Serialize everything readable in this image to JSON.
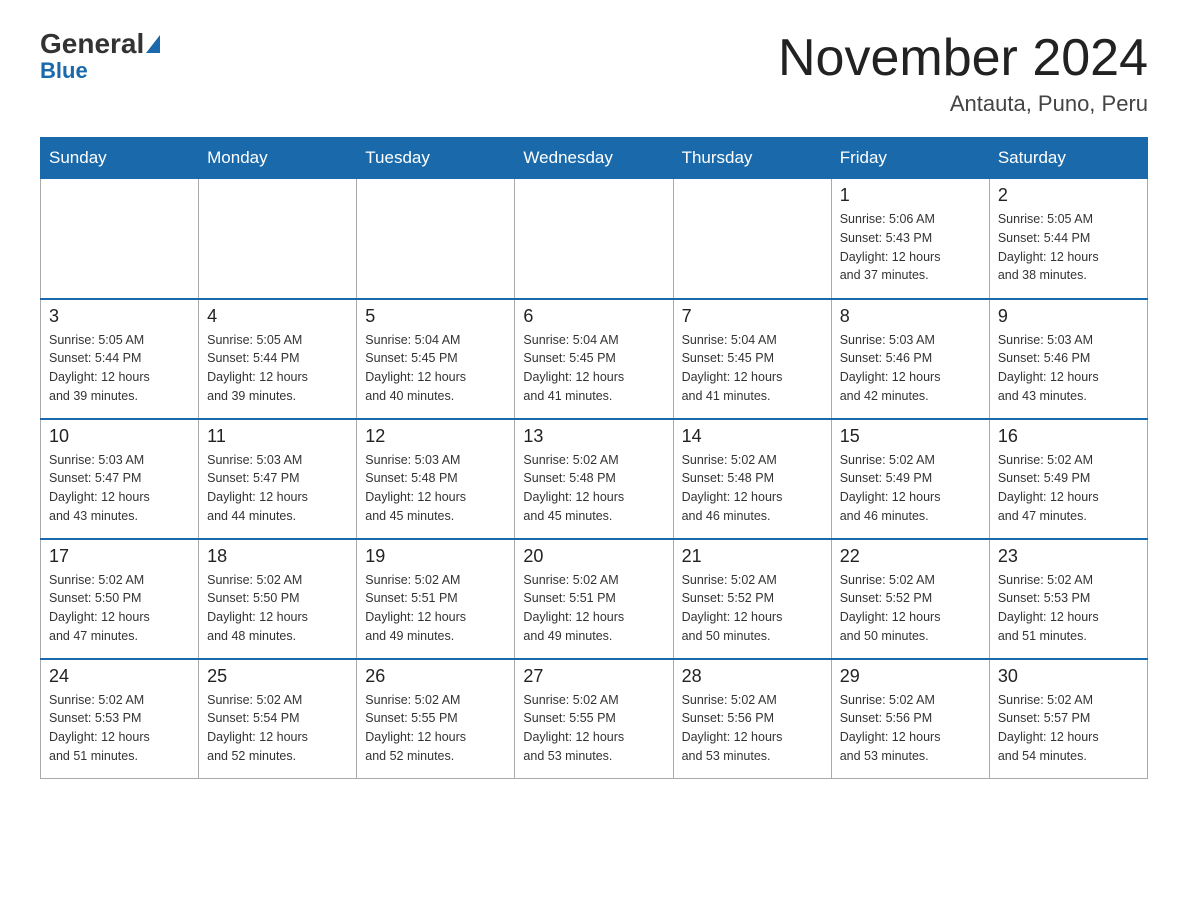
{
  "header": {
    "logo_general": "General",
    "logo_blue": "Blue",
    "month_title": "November 2024",
    "location": "Antauta, Puno, Peru"
  },
  "days_of_week": [
    "Sunday",
    "Monday",
    "Tuesday",
    "Wednesday",
    "Thursday",
    "Friday",
    "Saturday"
  ],
  "weeks": [
    {
      "days": [
        {
          "date": "",
          "info": ""
        },
        {
          "date": "",
          "info": ""
        },
        {
          "date": "",
          "info": ""
        },
        {
          "date": "",
          "info": ""
        },
        {
          "date": "",
          "info": ""
        },
        {
          "date": "1",
          "info": "Sunrise: 5:06 AM\nSunset: 5:43 PM\nDaylight: 12 hours\nand 37 minutes."
        },
        {
          "date": "2",
          "info": "Sunrise: 5:05 AM\nSunset: 5:44 PM\nDaylight: 12 hours\nand 38 minutes."
        }
      ]
    },
    {
      "days": [
        {
          "date": "3",
          "info": "Sunrise: 5:05 AM\nSunset: 5:44 PM\nDaylight: 12 hours\nand 39 minutes."
        },
        {
          "date": "4",
          "info": "Sunrise: 5:05 AM\nSunset: 5:44 PM\nDaylight: 12 hours\nand 39 minutes."
        },
        {
          "date": "5",
          "info": "Sunrise: 5:04 AM\nSunset: 5:45 PM\nDaylight: 12 hours\nand 40 minutes."
        },
        {
          "date": "6",
          "info": "Sunrise: 5:04 AM\nSunset: 5:45 PM\nDaylight: 12 hours\nand 41 minutes."
        },
        {
          "date": "7",
          "info": "Sunrise: 5:04 AM\nSunset: 5:45 PM\nDaylight: 12 hours\nand 41 minutes."
        },
        {
          "date": "8",
          "info": "Sunrise: 5:03 AM\nSunset: 5:46 PM\nDaylight: 12 hours\nand 42 minutes."
        },
        {
          "date": "9",
          "info": "Sunrise: 5:03 AM\nSunset: 5:46 PM\nDaylight: 12 hours\nand 43 minutes."
        }
      ]
    },
    {
      "days": [
        {
          "date": "10",
          "info": "Sunrise: 5:03 AM\nSunset: 5:47 PM\nDaylight: 12 hours\nand 43 minutes."
        },
        {
          "date": "11",
          "info": "Sunrise: 5:03 AM\nSunset: 5:47 PM\nDaylight: 12 hours\nand 44 minutes."
        },
        {
          "date": "12",
          "info": "Sunrise: 5:03 AM\nSunset: 5:48 PM\nDaylight: 12 hours\nand 45 minutes."
        },
        {
          "date": "13",
          "info": "Sunrise: 5:02 AM\nSunset: 5:48 PM\nDaylight: 12 hours\nand 45 minutes."
        },
        {
          "date": "14",
          "info": "Sunrise: 5:02 AM\nSunset: 5:48 PM\nDaylight: 12 hours\nand 46 minutes."
        },
        {
          "date": "15",
          "info": "Sunrise: 5:02 AM\nSunset: 5:49 PM\nDaylight: 12 hours\nand 46 minutes."
        },
        {
          "date": "16",
          "info": "Sunrise: 5:02 AM\nSunset: 5:49 PM\nDaylight: 12 hours\nand 47 minutes."
        }
      ]
    },
    {
      "days": [
        {
          "date": "17",
          "info": "Sunrise: 5:02 AM\nSunset: 5:50 PM\nDaylight: 12 hours\nand 47 minutes."
        },
        {
          "date": "18",
          "info": "Sunrise: 5:02 AM\nSunset: 5:50 PM\nDaylight: 12 hours\nand 48 minutes."
        },
        {
          "date": "19",
          "info": "Sunrise: 5:02 AM\nSunset: 5:51 PM\nDaylight: 12 hours\nand 49 minutes."
        },
        {
          "date": "20",
          "info": "Sunrise: 5:02 AM\nSunset: 5:51 PM\nDaylight: 12 hours\nand 49 minutes."
        },
        {
          "date": "21",
          "info": "Sunrise: 5:02 AM\nSunset: 5:52 PM\nDaylight: 12 hours\nand 50 minutes."
        },
        {
          "date": "22",
          "info": "Sunrise: 5:02 AM\nSunset: 5:52 PM\nDaylight: 12 hours\nand 50 minutes."
        },
        {
          "date": "23",
          "info": "Sunrise: 5:02 AM\nSunset: 5:53 PM\nDaylight: 12 hours\nand 51 minutes."
        }
      ]
    },
    {
      "days": [
        {
          "date": "24",
          "info": "Sunrise: 5:02 AM\nSunset: 5:53 PM\nDaylight: 12 hours\nand 51 minutes."
        },
        {
          "date": "25",
          "info": "Sunrise: 5:02 AM\nSunset: 5:54 PM\nDaylight: 12 hours\nand 52 minutes."
        },
        {
          "date": "26",
          "info": "Sunrise: 5:02 AM\nSunset: 5:55 PM\nDaylight: 12 hours\nand 52 minutes."
        },
        {
          "date": "27",
          "info": "Sunrise: 5:02 AM\nSunset: 5:55 PM\nDaylight: 12 hours\nand 53 minutes."
        },
        {
          "date": "28",
          "info": "Sunrise: 5:02 AM\nSunset: 5:56 PM\nDaylight: 12 hours\nand 53 minutes."
        },
        {
          "date": "29",
          "info": "Sunrise: 5:02 AM\nSunset: 5:56 PM\nDaylight: 12 hours\nand 53 minutes."
        },
        {
          "date": "30",
          "info": "Sunrise: 5:02 AM\nSunset: 5:57 PM\nDaylight: 12 hours\nand 54 minutes."
        }
      ]
    }
  ]
}
